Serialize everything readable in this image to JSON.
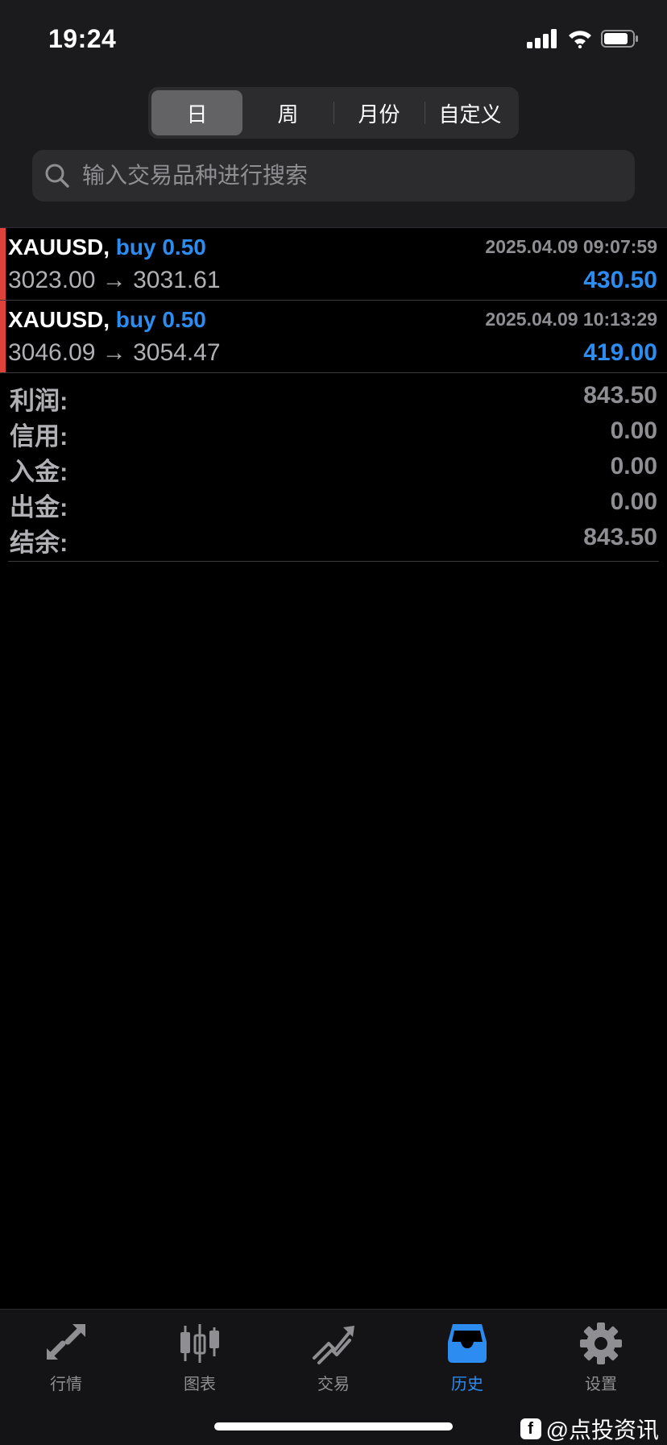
{
  "status_bar": {
    "time": "19:24"
  },
  "segments": [
    {
      "label": "日",
      "active": true
    },
    {
      "label": "周",
      "active": false
    },
    {
      "label": "月份",
      "active": false
    },
    {
      "label": "自定义",
      "active": false
    }
  ],
  "search": {
    "placeholder": "输入交易品种进行搜索"
  },
  "trades": [
    {
      "symbol": "XAUUSD,",
      "side": "buy 0.50",
      "datetime": "2025.04.09 09:07:59",
      "prices": "3023.00 → 3031.61",
      "profit": "430.50"
    },
    {
      "symbol": "XAUUSD,",
      "side": "buy 0.50",
      "datetime": "2025.04.09 10:13:29",
      "prices": "3046.09 → 3054.47",
      "profit": "419.00"
    }
  ],
  "summary": [
    {
      "label": "利润:",
      "value": "843.50"
    },
    {
      "label": "信用:",
      "value": "0.00"
    },
    {
      "label": "入金:",
      "value": "0.00"
    },
    {
      "label": "出金:",
      "value": "0.00"
    },
    {
      "label": "结余:",
      "value": "843.50"
    }
  ],
  "tabbar": [
    {
      "label": "行情",
      "icon": "quotes-arrows-icon",
      "active": false
    },
    {
      "label": "图表",
      "icon": "candlestick-chart-icon",
      "active": false
    },
    {
      "label": "交易",
      "icon": "trade-trend-icon",
      "active": false
    },
    {
      "label": "历史",
      "icon": "history-inbox-icon",
      "active": true
    },
    {
      "label": "设置",
      "icon": "gear-icon",
      "active": false
    }
  ],
  "watermark": {
    "text": "@点投资讯"
  },
  "colors": {
    "accent": "#2d8cf0",
    "buy_bar": "#e0413a",
    "background": "#000000",
    "header": "#1b1b1d"
  }
}
